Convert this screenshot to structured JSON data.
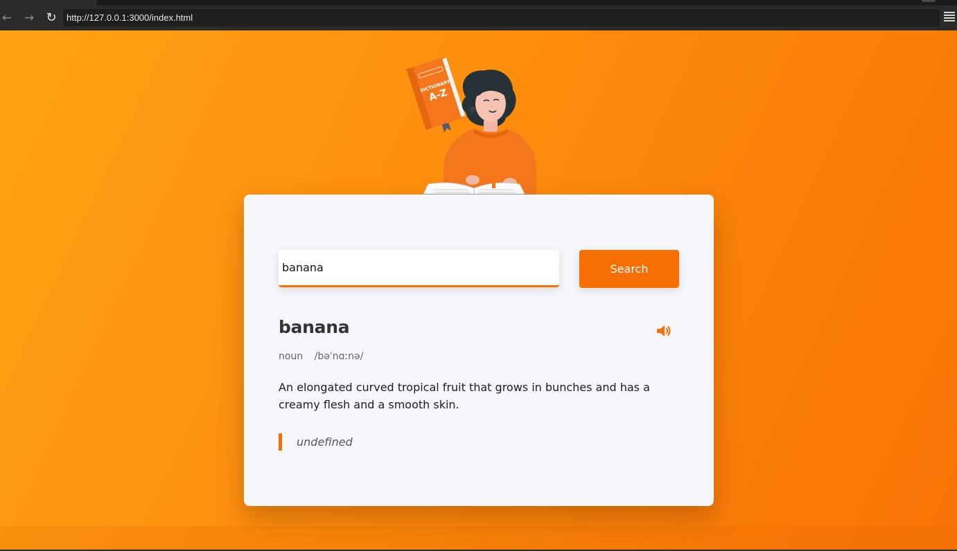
{
  "browser": {
    "url": "http://127.0.0.1:3000/index.html",
    "back_icon": "arrow-left-icon",
    "forward_icon": "arrow-right-icon",
    "reload_icon": "reload-icon",
    "menu_icon": "hamburger-menu-icon"
  },
  "illustration": {
    "book_label_top": "DICTIONARY",
    "book_label_main": "A-Z"
  },
  "search": {
    "value": "banana",
    "button_label": "Search"
  },
  "result": {
    "word": "banana",
    "part_of_speech": "noun",
    "phonetic": "/bəˈnɑːnə/",
    "definition": "An elongated curved tropical fruit that grows in bunches and has a creamy flesh and a smooth skin.",
    "example": "undefined",
    "sound_icon": "volume-up-icon"
  },
  "colors": {
    "accent": "#f56f05",
    "background_start": "#ffa214",
    "background_end": "#f87306",
    "card": "#f6f7fb"
  }
}
